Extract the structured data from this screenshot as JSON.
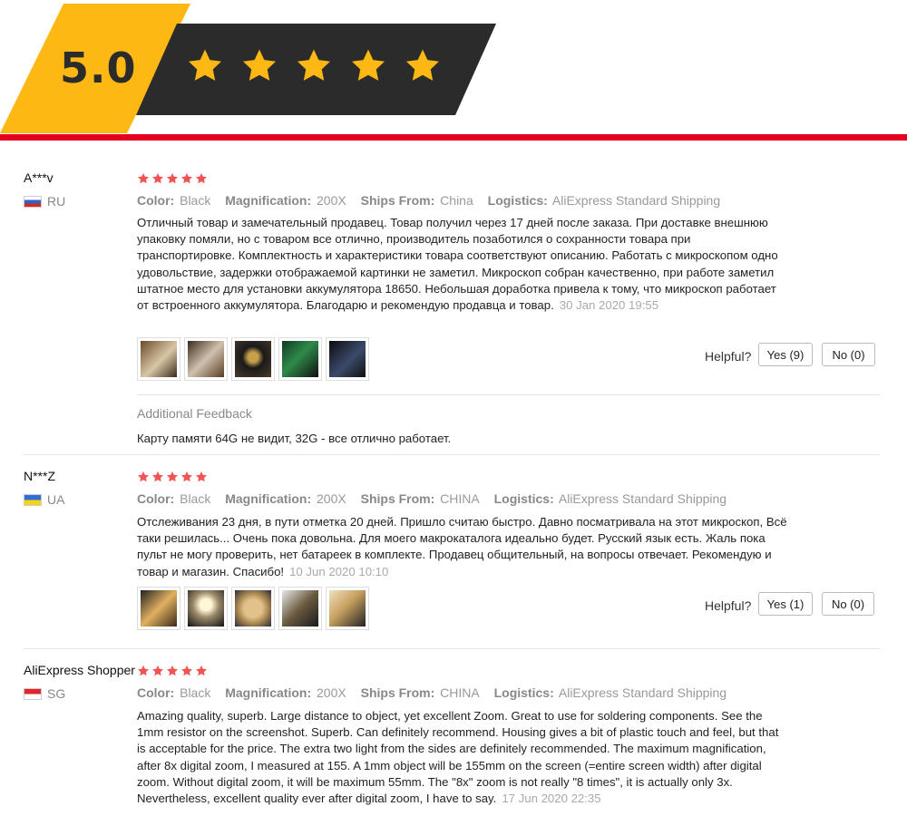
{
  "rating": {
    "score": "5.0",
    "stars": 5,
    "colors": {
      "yellow": "#fdb813",
      "dark": "#2b2b2b",
      "accent_line": "#e6001f",
      "star_red": "#f25454"
    }
  },
  "labels": {
    "color": "Color:",
    "magnification": "Magnification:",
    "ships_from": "Ships From:",
    "logistics": "Logistics:",
    "helpful": "Helpful?",
    "additional_feedback": "Additional Feedback"
  },
  "reviews": [
    {
      "user": "A***v",
      "country": "RU",
      "flag": "russia-flag",
      "stars": 5,
      "color": "Black",
      "magnification": "200X",
      "ships_from": "China",
      "logistics": "AliExpress Standard Shipping",
      "text": "Отличный товар и замечательный продавец. Товар получил через 17 дней после заказа. При доставке внешнюю упаковку помяли, но с товаром все отлично, производитель позаботился о сохранности товара при транспортировке. Комплектность и характеристики товара соответствуют описанию. Работать с микроскопом одно удовольствие, задержки отображаемой картинки не заметил. Микроскоп собран качественно, при работе заметил штатное место для установки аккумулятора 18650. Небольшая доработка привела к тому, что микроскоп работает от встроенного аккумулятора. Благодарю и рекомендую продавца и товар.",
      "date": "30 Jan 2020 19:55",
      "yes": "Yes (9)",
      "no": "No (0)",
      "additional": "Карту памяти 64G не видит, 32G - все отлично работает."
    },
    {
      "user": "N***Z",
      "country": "UA",
      "flag": "ukraine-flag",
      "stars": 5,
      "color": "Black",
      "magnification": "200X",
      "ships_from": "CHINA",
      "logistics": "AliExpress Standard Shipping",
      "text": "Отслеживания 23 дня, в пути отметка 20 дней. Пришло считаю быстро. Давно посматривала на этот микроскоп, Всё таки решилась... Очень пока довольна. Для моего макрокаталога идеально будет. Русский язык есть. Жаль пока пульт не могу проверить, нет батареек в комплекте. Продавец общительный, на вопросы отвечает. Рекомендую и товар и магазин. Спасибо!",
      "date": "10 Jun 2020 10:10",
      "yes": "Yes (1)",
      "no": "No (0)"
    },
    {
      "user": "AliExpress Shopper",
      "country": "SG",
      "flag": "singapore-flag",
      "stars": 5,
      "color": "Black",
      "magnification": "200X",
      "ships_from": "CHINA",
      "logistics": "AliExpress Standard Shipping",
      "text": "Amazing quality, superb. Large distance to object, yet excellent Zoom. Great to use for soldering components. See the 1mm resistor on the screenshot. Superb. Can definitely recommend. Housing gives a bit of plastic touch and feel, but that is acceptable for the price. The extra two light from the sides are definitely recommended. The maximum magnification, after 8x digital zoom, I measured at 155. A 1mm object will be 155mm on the screen (=entire screen width) after digital zoom. Without digital zoom, it will be maximum 55mm. The \"8x\" zoom is not really \"8 times\", it is actually only 3x. Nevertheless, excellent quality ever after digital zoom, I have to say.",
      "date": "17 Jun 2020 22:35"
    }
  ]
}
